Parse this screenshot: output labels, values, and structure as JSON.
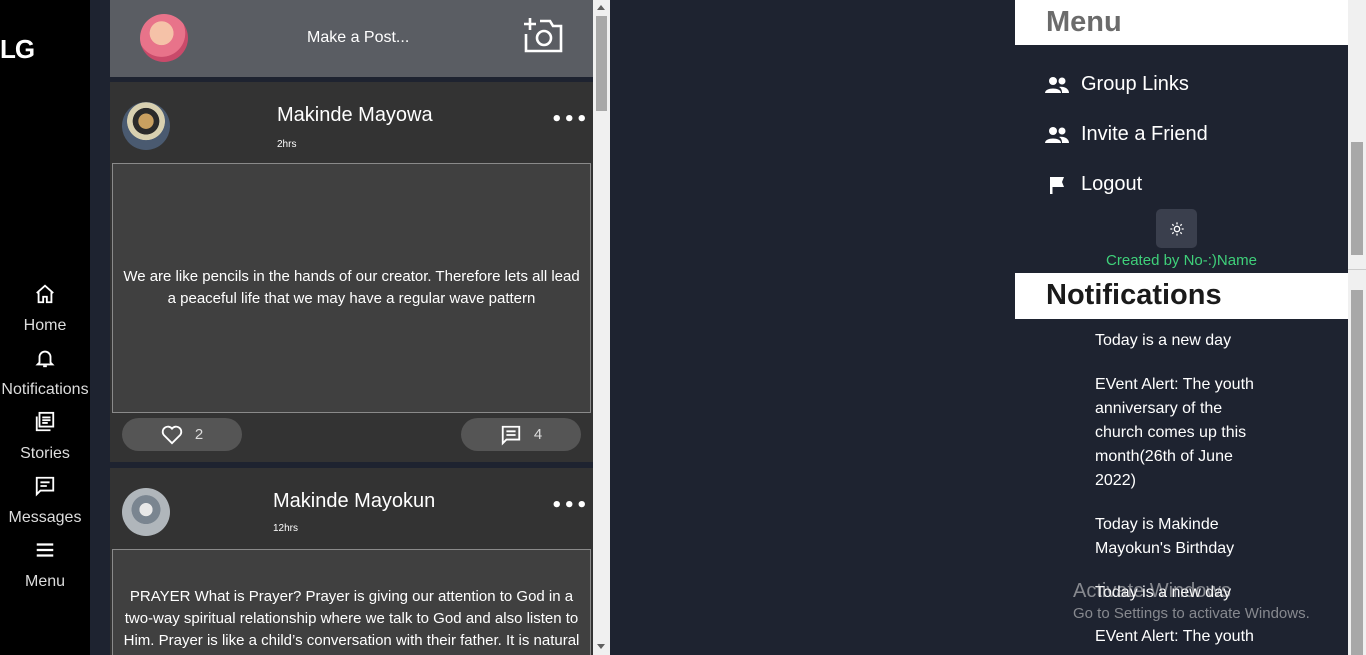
{
  "app": {
    "logo": "LG"
  },
  "nav": {
    "items": [
      {
        "label": "Home",
        "icon": "home-icon"
      },
      {
        "label": "Notifications",
        "icon": "bell-icon"
      },
      {
        "label": "Stories",
        "icon": "stories-icon"
      },
      {
        "label": "Messages",
        "icon": "message-icon"
      },
      {
        "label": "Menu",
        "icon": "hamburger-icon"
      }
    ]
  },
  "composer": {
    "prompt": "Make a Post...",
    "icon": "add-photo-icon"
  },
  "posts": [
    {
      "author": "Makinde Mayowa",
      "time": "2hrs",
      "body": "We are like pencils in the hands of our creator. Therefore lets all lead a peaceful life that we may have a regular wave pattern",
      "likes": "2",
      "comments": "4"
    },
    {
      "author": "Makinde Mayokun",
      "time": "12hrs",
      "body": "PRAYER What is Prayer? Prayer is giving our attention to God in a two-way spiritual relationship where we talk to God and also listen to Him. Prayer is like a child’s conversation with their father. It is natural"
    }
  ],
  "menu": {
    "title": "Menu",
    "items": [
      {
        "label": "Group Links",
        "icon": "group-icon"
      },
      {
        "label": "Invite a Friend",
        "icon": "group-icon"
      },
      {
        "label": "Logout",
        "icon": "flag-icon"
      }
    ],
    "theme_toggle_icon": "sun-icon",
    "credit": "Created by No-:)Name"
  },
  "notifications": {
    "title": "Notifications",
    "items": [
      "Today is a new day",
      "EVent Alert: The youth anniversary of the church comes up this month(26th of June 2022)",
      "Today is Makinde Mayokun's Birthday",
      "Today is a new day",
      "EVent Alert: The youth"
    ]
  },
  "watermark": {
    "line1": "Activate Windows",
    "line2": "Go to Settings to activate Windows."
  },
  "colors": {
    "accent_green": "#3fd07a",
    "panel": "#1e2330",
    "post_bg": "#333333"
  }
}
